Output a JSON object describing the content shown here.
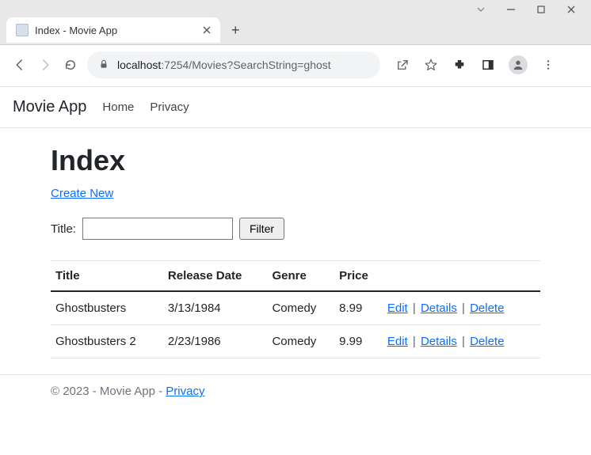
{
  "browser": {
    "tab_title": "Index - Movie App",
    "url_host": "localhost",
    "url_port_path": ":7254/Movies?SearchString=ghost"
  },
  "navbar": {
    "brand": "Movie App",
    "links": [
      "Home",
      "Privacy"
    ]
  },
  "page": {
    "heading": "Index",
    "create_link": "Create New",
    "filter": {
      "label": "Title:",
      "input_value": "",
      "button": "Filter"
    }
  },
  "table": {
    "headers": [
      "Title",
      "Release Date",
      "Genre",
      "Price",
      ""
    ],
    "rows": [
      {
        "title": "Ghostbusters",
        "release": "3/13/1984",
        "genre": "Comedy",
        "price": "8.99"
      },
      {
        "title": "Ghostbusters 2",
        "release": "2/23/1986",
        "genre": "Comedy",
        "price": "9.99"
      }
    ],
    "actions": {
      "edit": "Edit",
      "details": "Details",
      "delete": "Delete"
    }
  },
  "footer": {
    "copyright": "© 2023 - Movie App - ",
    "privacy": "Privacy"
  }
}
